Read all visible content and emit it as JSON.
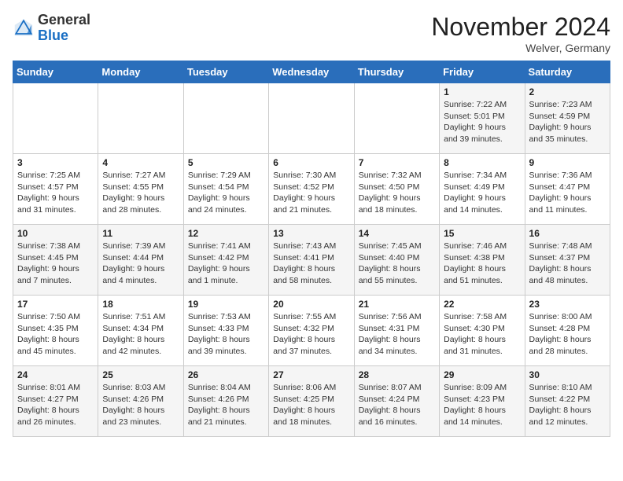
{
  "logo": {
    "general": "General",
    "blue": "Blue"
  },
  "title": "November 2024",
  "location": "Welver, Germany",
  "days_of_week": [
    "Sunday",
    "Monday",
    "Tuesday",
    "Wednesday",
    "Thursday",
    "Friday",
    "Saturday"
  ],
  "weeks": [
    [
      {
        "day": "",
        "info": ""
      },
      {
        "day": "",
        "info": ""
      },
      {
        "day": "",
        "info": ""
      },
      {
        "day": "",
        "info": ""
      },
      {
        "day": "",
        "info": ""
      },
      {
        "day": "1",
        "info": "Sunrise: 7:22 AM\nSunset: 5:01 PM\nDaylight: 9 hours\nand 39 minutes."
      },
      {
        "day": "2",
        "info": "Sunrise: 7:23 AM\nSunset: 4:59 PM\nDaylight: 9 hours\nand 35 minutes."
      }
    ],
    [
      {
        "day": "3",
        "info": "Sunrise: 7:25 AM\nSunset: 4:57 PM\nDaylight: 9 hours\nand 31 minutes."
      },
      {
        "day": "4",
        "info": "Sunrise: 7:27 AM\nSunset: 4:55 PM\nDaylight: 9 hours\nand 28 minutes."
      },
      {
        "day": "5",
        "info": "Sunrise: 7:29 AM\nSunset: 4:54 PM\nDaylight: 9 hours\nand 24 minutes."
      },
      {
        "day": "6",
        "info": "Sunrise: 7:30 AM\nSunset: 4:52 PM\nDaylight: 9 hours\nand 21 minutes."
      },
      {
        "day": "7",
        "info": "Sunrise: 7:32 AM\nSunset: 4:50 PM\nDaylight: 9 hours\nand 18 minutes."
      },
      {
        "day": "8",
        "info": "Sunrise: 7:34 AM\nSunset: 4:49 PM\nDaylight: 9 hours\nand 14 minutes."
      },
      {
        "day": "9",
        "info": "Sunrise: 7:36 AM\nSunset: 4:47 PM\nDaylight: 9 hours\nand 11 minutes."
      }
    ],
    [
      {
        "day": "10",
        "info": "Sunrise: 7:38 AM\nSunset: 4:45 PM\nDaylight: 9 hours\nand 7 minutes."
      },
      {
        "day": "11",
        "info": "Sunrise: 7:39 AM\nSunset: 4:44 PM\nDaylight: 9 hours\nand 4 minutes."
      },
      {
        "day": "12",
        "info": "Sunrise: 7:41 AM\nSunset: 4:42 PM\nDaylight: 9 hours\nand 1 minute."
      },
      {
        "day": "13",
        "info": "Sunrise: 7:43 AM\nSunset: 4:41 PM\nDaylight: 8 hours\nand 58 minutes."
      },
      {
        "day": "14",
        "info": "Sunrise: 7:45 AM\nSunset: 4:40 PM\nDaylight: 8 hours\nand 55 minutes."
      },
      {
        "day": "15",
        "info": "Sunrise: 7:46 AM\nSunset: 4:38 PM\nDaylight: 8 hours\nand 51 minutes."
      },
      {
        "day": "16",
        "info": "Sunrise: 7:48 AM\nSunset: 4:37 PM\nDaylight: 8 hours\nand 48 minutes."
      }
    ],
    [
      {
        "day": "17",
        "info": "Sunrise: 7:50 AM\nSunset: 4:35 PM\nDaylight: 8 hours\nand 45 minutes."
      },
      {
        "day": "18",
        "info": "Sunrise: 7:51 AM\nSunset: 4:34 PM\nDaylight: 8 hours\nand 42 minutes."
      },
      {
        "day": "19",
        "info": "Sunrise: 7:53 AM\nSunset: 4:33 PM\nDaylight: 8 hours\nand 39 minutes."
      },
      {
        "day": "20",
        "info": "Sunrise: 7:55 AM\nSunset: 4:32 PM\nDaylight: 8 hours\nand 37 minutes."
      },
      {
        "day": "21",
        "info": "Sunrise: 7:56 AM\nSunset: 4:31 PM\nDaylight: 8 hours\nand 34 minutes."
      },
      {
        "day": "22",
        "info": "Sunrise: 7:58 AM\nSunset: 4:30 PM\nDaylight: 8 hours\nand 31 minutes."
      },
      {
        "day": "23",
        "info": "Sunrise: 8:00 AM\nSunset: 4:28 PM\nDaylight: 8 hours\nand 28 minutes."
      }
    ],
    [
      {
        "day": "24",
        "info": "Sunrise: 8:01 AM\nSunset: 4:27 PM\nDaylight: 8 hours\nand 26 minutes."
      },
      {
        "day": "25",
        "info": "Sunrise: 8:03 AM\nSunset: 4:26 PM\nDaylight: 8 hours\nand 23 minutes."
      },
      {
        "day": "26",
        "info": "Sunrise: 8:04 AM\nSunset: 4:26 PM\nDaylight: 8 hours\nand 21 minutes."
      },
      {
        "day": "27",
        "info": "Sunrise: 8:06 AM\nSunset: 4:25 PM\nDaylight: 8 hours\nand 18 minutes."
      },
      {
        "day": "28",
        "info": "Sunrise: 8:07 AM\nSunset: 4:24 PM\nDaylight: 8 hours\nand 16 minutes."
      },
      {
        "day": "29",
        "info": "Sunrise: 8:09 AM\nSunset: 4:23 PM\nDaylight: 8 hours\nand 14 minutes."
      },
      {
        "day": "30",
        "info": "Sunrise: 8:10 AM\nSunset: 4:22 PM\nDaylight: 8 hours\nand 12 minutes."
      }
    ]
  ]
}
